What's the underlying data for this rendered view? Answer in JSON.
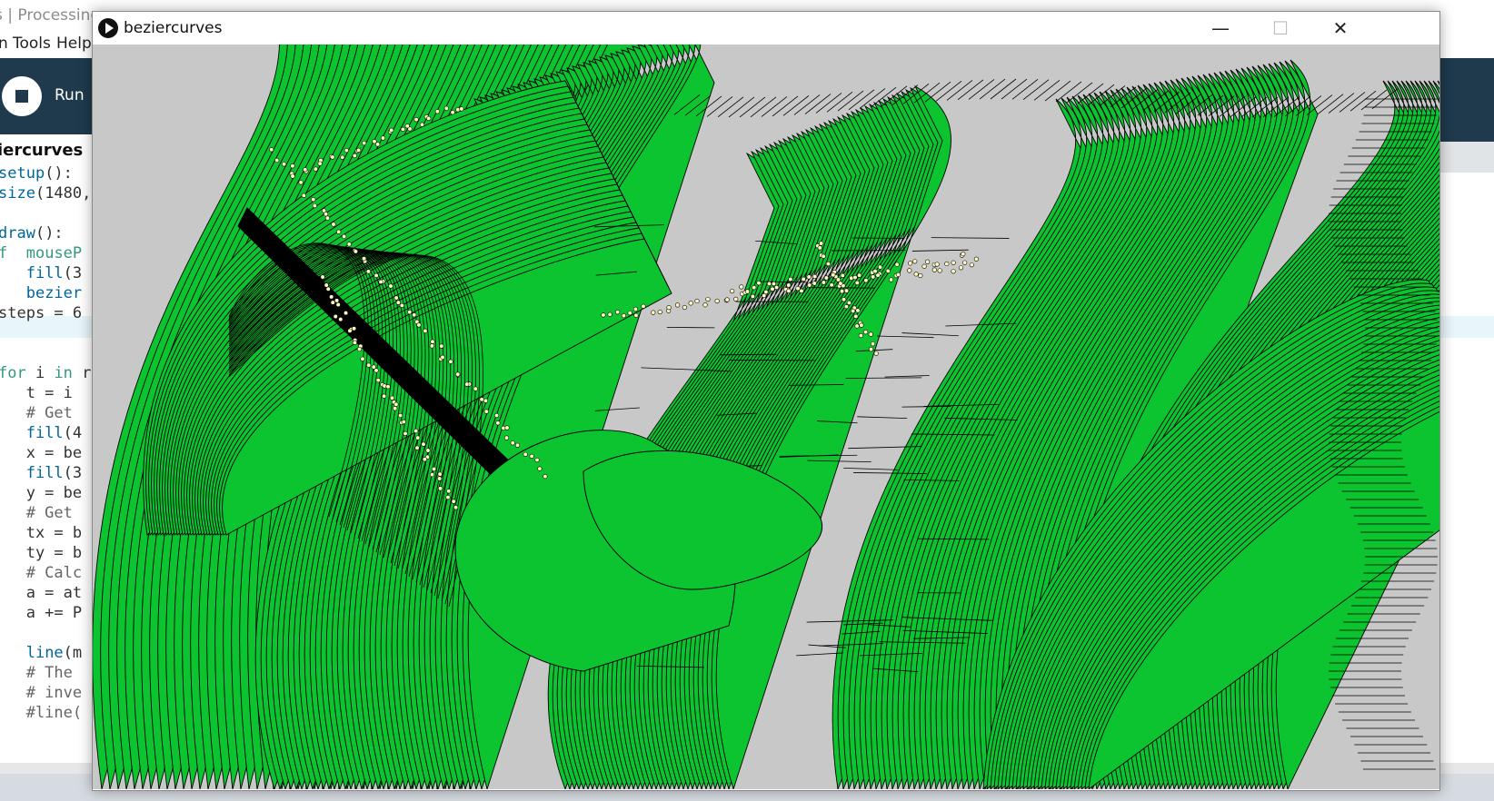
{
  "ide": {
    "title": "s | Processing",
    "menu": [
      "n",
      "Tools",
      "Help"
    ],
    "run_label": "Run",
    "tab_label": "iercurves",
    "code_lines": [
      "setup():",
      "size(1480,",
      "",
      "draw():",
      "f  mouseP",
      "   fill(3",
      "   bezier",
      "steps = 6",
      "",
      "",
      "for i in r",
      "   t = i",
      "   # Get",
      "   fill(4",
      "   x = be",
      "   fill(3",
      "   y = be",
      "   # Get",
      "   tx = b",
      "   ty = b",
      "   # Calc",
      "   a = at",
      "   a += P",
      "",
      "   line(m",
      "   # The",
      "   # inve",
      "   #line(",
      "   "
    ]
  },
  "sketch_window": {
    "title": "beziercurves",
    "icon": "processing-play-icon",
    "minimize_glyph": "—",
    "maximize_glyph": "☐",
    "close_glyph": "✕",
    "colors": {
      "fill_green": "#0cc42f",
      "stroke": "#000000",
      "dot_fill": "#fff7c2",
      "canvas_bg": "#c8c8c8"
    }
  }
}
